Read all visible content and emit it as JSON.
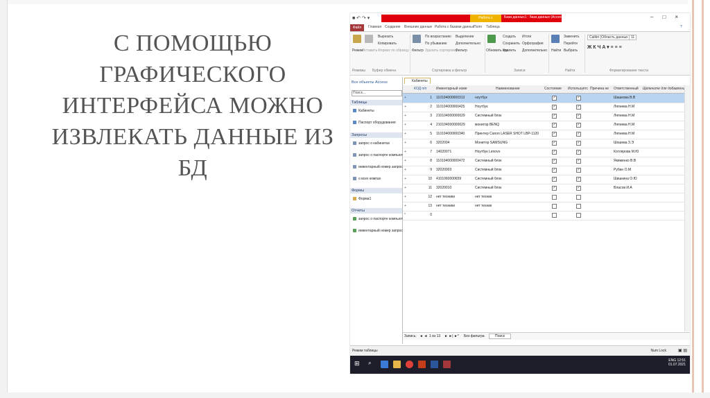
{
  "slide": {
    "title_lines": [
      "С ПОМОЩЬЮ",
      "ГРАФИЧЕСКОГО",
      "ИНТЕРФЕЙСА МОЖНО",
      "ИЗВЛЕКАТЬ ДАННЫЕ ИЗ БД"
    ]
  },
  "window": {
    "context_tab": "Работа с таблицами",
    "title": "База данных1 : база данных (Access 2007) - Microsoft Access (сбой активации продукта)",
    "controls": [
      "–",
      "□",
      "×"
    ]
  },
  "ribbon_tabs": [
    "Файл",
    "Главная",
    "Создание",
    "Внешние данные",
    "Работа с базами данных",
    "Поля",
    "Таблица"
  ],
  "ribbon": {
    "groups": [
      "Режимы",
      "Буфер обмена",
      "Сортировка и фильтр",
      "Записи",
      "Найти",
      "Форматирование текста"
    ],
    "buttons": {
      "mode": "Режим",
      "paste": "Вставить",
      "cut": "Вырезать",
      "copy": "Копировать",
      "format_painter": "Формат по образцу",
      "filter": "Фильтр",
      "asc": "По возрастанию",
      "desc": "По убыванию",
      "remove_sort": "Удалить сортировку",
      "selection": "Выделение",
      "advanced": "Дополнительно",
      "toggle_filter": "Фильтр",
      "refresh": "Обновить все",
      "new": "Создать",
      "save": "Сохранить",
      "delete": "Удалить",
      "totals": "Итоги",
      "spelling": "Орфография",
      "more": "Дополнительно",
      "find": "Найти",
      "replace": "Заменить",
      "goto": "Перейти",
      "select": "Выбрать",
      "font": "Calibri (Область данных",
      "font_size": "11"
    }
  },
  "nav": {
    "header": "Все объекты Access",
    "search_placeholder": "Поиск...",
    "sections": [
      {
        "title": "Таблицы",
        "items": [
          "Кабинеты",
          "Паспорт оборудования"
        ]
      },
      {
        "title": "Запросы",
        "items": [
          "запрос о кабинетах",
          "запрос о паспорте компьютер",
          "инвентарный номер запрос",
          "о всех компах"
        ]
      },
      {
        "title": "Формы",
        "items": [
          "Форма1"
        ]
      },
      {
        "title": "Отчеты",
        "items": [
          "запрос о паспорте компьютер",
          "инвентарный номер запрос"
        ]
      }
    ]
  },
  "doc_tab": "Кабинеты",
  "columns": [
    "КОД п/п",
    "Инвентарный номе",
    "Наименование",
    "Состояние",
    "Используетс",
    "Причина не",
    "Ответственный",
    "Щелкните для добавления"
  ],
  "rows": [
    {
      "id": "1",
      "inv": "110104000000313",
      "name": "ноутбук",
      "state": true,
      "used": true,
      "resp": "Шашкова В.В",
      "selected": true
    },
    {
      "id": "2",
      "inv": "110104000000425",
      "name": "Ноутбук",
      "state": true,
      "used": true,
      "resp": "Ляпнева Н.М"
    },
    {
      "id": "3",
      "inv": "210104000000029",
      "name": "Системный блок",
      "state": true,
      "used": true,
      "resp": "Ляпнева Н.М"
    },
    {
      "id": "4",
      "inv": "210104000000029",
      "name": "монитор BENQ",
      "state": true,
      "used": true,
      "resp": "Ляпнева Н.М"
    },
    {
      "id": "5",
      "inv": "110104000000340",
      "name": "Принтер Canon LASER SHOT LBP-1120",
      "state": true,
      "used": true,
      "resp": "Ляпнева Н.М"
    },
    {
      "id": "6",
      "inv": "3202004",
      "name": "Монитор SAMSUNG",
      "state": true,
      "used": true,
      "resp": "Шошева З.Э"
    },
    {
      "id": "7",
      "inv": "14020071",
      "name": "Ноутбук Lenovo",
      "state": true,
      "used": true,
      "resp": "Котлярова М.Ю"
    },
    {
      "id": "8",
      "inv": "110104000000472",
      "name": "Системный блок",
      "state": true,
      "used": true,
      "resp": "Якименко В.В"
    },
    {
      "id": "9",
      "inv": "32020003",
      "name": "Системный блок",
      "state": true,
      "used": true,
      "resp": "Рубан О.М"
    },
    {
      "id": "10",
      "inv": "4101060000659",
      "name": "Системный блок",
      "state": true,
      "used": true,
      "resp": "Шишкина О.Ю"
    },
    {
      "id": "11",
      "inv": "32020010",
      "name": "Системный блок",
      "state": true,
      "used": true,
      "resp": "Власов И.А"
    },
    {
      "id": "12",
      "inv": "нет техники",
      "name": "нет техник",
      "state": false,
      "used": false,
      "resp": ""
    },
    {
      "id": "13",
      "inv": "нет техники",
      "name": "нет техник",
      "state": false,
      "used": false,
      "resp": ""
    },
    {
      "id": "0",
      "inv": "",
      "name": "",
      "state": false,
      "used": false,
      "resp": "",
      "new_row": true
    }
  ],
  "record_nav": {
    "label": "Запись:",
    "position": "1 из 13",
    "filter": "Без фильтра",
    "search": "Поиск"
  },
  "status": {
    "left": "Режим таблицы",
    "right": "Num Lock"
  },
  "tray": {
    "lang": "ENG",
    "time": "12:51",
    "date": "01.07.2021"
  },
  "colors": {
    "access_red": "#a4373a",
    "selection": "#b8d4f0",
    "titlebar_red": "#e0000c",
    "context_tab": "#f0b400"
  }
}
